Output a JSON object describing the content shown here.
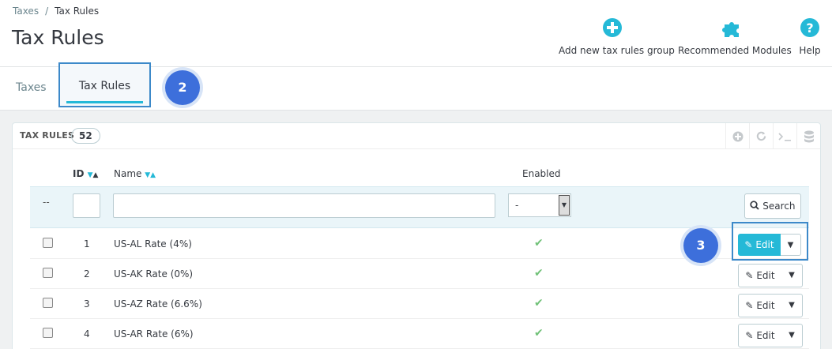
{
  "breadcrumb": {
    "parent": "Taxes",
    "separator": "/",
    "current": "Tax Rules"
  },
  "page_title": "Tax Rules",
  "toolbar": {
    "add_label": "Add new tax rules group",
    "modules_label": "Recommended Modules",
    "help_label": "Help"
  },
  "tabs": [
    {
      "label": "Taxes",
      "active": false
    },
    {
      "label": "Tax Rules",
      "active": true
    }
  ],
  "steps": {
    "tab_step": "2",
    "edit_step": "3"
  },
  "panel": {
    "title": "TAX RULES",
    "count": "52"
  },
  "table": {
    "columns": {
      "id": "ID",
      "name": "Name",
      "enabled": "Enabled"
    },
    "filter": {
      "dash": "--",
      "enabled_value": "-",
      "search_label": "Search"
    },
    "rows": [
      {
        "id": "1",
        "name": "US-AL Rate (4%)",
        "enabled": "✔",
        "edit": "Edit"
      },
      {
        "id": "2",
        "name": "US-AK Rate (0%)",
        "enabled": "✔",
        "edit": "Edit"
      },
      {
        "id": "3",
        "name": "US-AZ Rate (6.6%)",
        "enabled": "✔",
        "edit": "Edit"
      },
      {
        "id": "4",
        "name": "US-AR Rate (6%)",
        "enabled": "✔",
        "edit": "Edit"
      }
    ]
  },
  "colors": {
    "accent": "#25b9d7",
    "highlight": "#3c89c9",
    "badge": "#3d6fdb",
    "check": "#72c279"
  }
}
